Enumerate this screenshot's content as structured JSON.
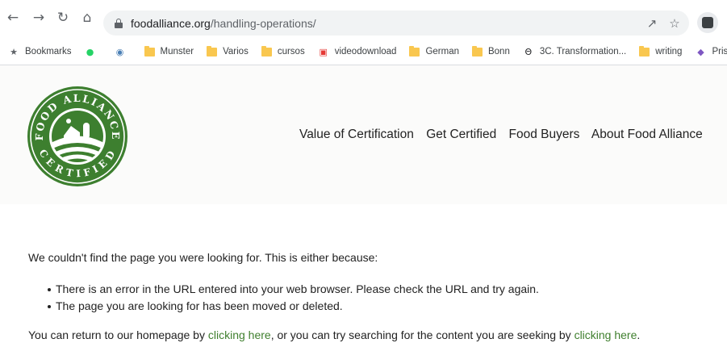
{
  "browser": {
    "url_domain": "foodalliance.org",
    "url_path": "/handling-operations/"
  },
  "bookmarks": [
    {
      "label": "Bookmarks",
      "icon": "star-icon"
    },
    {
      "label": "",
      "icon": "whatsapp-icon"
    },
    {
      "label": "",
      "icon": "globe-icon"
    },
    {
      "label": "Munster",
      "icon": "folder-icon"
    },
    {
      "label": "Varios",
      "icon": "folder-icon"
    },
    {
      "label": "cursos",
      "icon": "folder-icon"
    },
    {
      "label": "videodownload",
      "icon": "download-icon"
    },
    {
      "label": "German",
      "icon": "folder-icon"
    },
    {
      "label": "Bonn",
      "icon": "folder-icon"
    },
    {
      "label": "3C. Transformation...",
      "icon": "threads-icon"
    },
    {
      "label": "writing",
      "icon": "folder-icon"
    },
    {
      "label": "Prism - C",
      "icon": "prism-icon"
    }
  ],
  "logo": {
    "top_text": "FOOD ALLIANCE",
    "bottom_text": "CERTIFIED",
    "color": "#3d7f2f"
  },
  "nav": [
    "Value of Certification",
    "Get Certified",
    "Food Buyers",
    "About Food Alliance"
  ],
  "error": {
    "intro": "We couldn't find the page you were looking for. This is either because:",
    "reasons": [
      "There is an error in the URL entered into your web browser. Please check the URL and try again.",
      "The page you are looking for has been moved or deleted."
    ],
    "return_prefix": "You can return to our homepage by ",
    "link1": "clicking here",
    "return_middle": ", or you can try searching for the content you are seeking by ",
    "link2": "clicking here",
    "return_suffix": "."
  },
  "colors": {
    "link": "#3f7f2e",
    "brand_green": "#3d7f2f"
  }
}
